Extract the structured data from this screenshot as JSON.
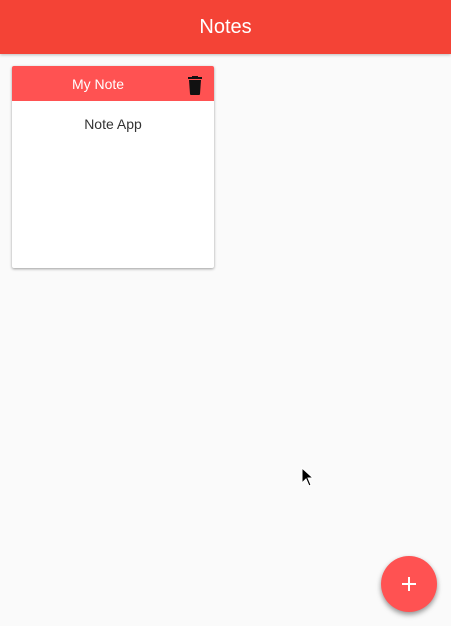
{
  "app_bar": {
    "title": "Notes",
    "color": "#f44336"
  },
  "notes": [
    {
      "title": "My Note",
      "body": "Note App",
      "header_color": "#ff5252",
      "delete_icon": "trash-icon"
    }
  ],
  "fab": {
    "icon": "plus-icon",
    "color": "#ff5252"
  },
  "cursor": {
    "icon": "mouse-pointer-icon"
  }
}
